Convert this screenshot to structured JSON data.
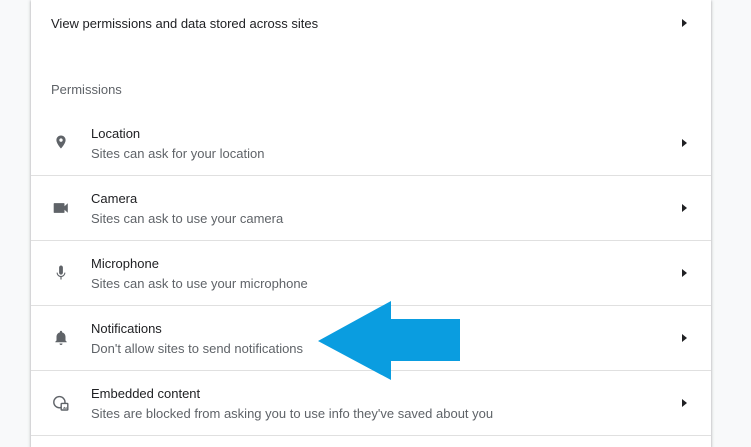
{
  "top_item": {
    "label": "View permissions and data stored across sites"
  },
  "permissions": {
    "title": "Permissions",
    "items": [
      {
        "icon": "location-pin-icon",
        "title": "Location",
        "subtitle": "Sites can ask for your location"
      },
      {
        "icon": "camera-icon",
        "title": "Camera",
        "subtitle": "Sites can ask to use your camera"
      },
      {
        "icon": "microphone-icon",
        "title": "Microphone",
        "subtitle": "Sites can ask to use your microphone"
      },
      {
        "icon": "bell-icon",
        "title": "Notifications",
        "subtitle": "Don't allow sites to send notifications"
      },
      {
        "icon": "embedded-content-icon",
        "title": "Embedded content",
        "subtitle": "Sites are blocked from asking you to use info they've saved about you"
      }
    ]
  },
  "colors": {
    "text_primary": "#202124",
    "text_secondary": "#5f6368",
    "icon": "#5f6368",
    "annotation_arrow": "#0a9de0"
  }
}
